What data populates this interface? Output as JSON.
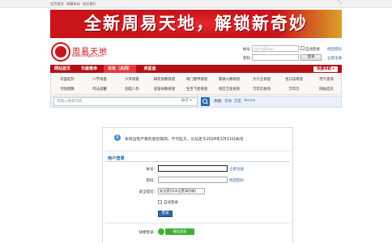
{
  "topbar": {
    "links": [
      "设为首页",
      "收藏本站",
      "社区银行"
    ]
  },
  "banner": {
    "text": "全新周易天地，解锁新奇妙"
  },
  "logo": {
    "name": "周易天地",
    "url": "www.f64gua.com"
  },
  "mini_login": {
    "account_label": "帐号",
    "account_placeholder": "用户名/Email",
    "auto_login_label": "自动登录",
    "retrieve_password": "找回密码",
    "password_label": "密码",
    "login_button": "登录",
    "register_link": "立即注册"
  },
  "nav": {
    "items": [
      "网站首页",
      "华盛黄命",
      "论坛（关闭）",
      "资星盘"
    ],
    "quick_nav": "快捷导航 ▾"
  },
  "subnav": {
    "row1": [
      "华盛起卦",
      "八字排盘",
      "六爻排盘",
      "梅花易数排盘",
      "奇门遁甲排盘",
      "紫微斗数排盘",
      "大六壬排盘",
      "金口诀排盘",
      "宅气查询"
    ],
    "row2": [
      "河洛理数",
      "鸣法战鑒",
      "割选八卦",
      "星宿命数排盘",
      "生世飞星排盘",
      "地区吉星查询",
      "万年历查询",
      "万年历",
      "网站首页"
    ]
  },
  "search": {
    "placeholder": "请输入搜索内容",
    "scope": "帖子 ▾",
    "hot_label": "热搜:",
    "hot_terms": [
      "活动",
      "交友",
      "discuz"
    ]
  },
  "alert": {
    "text": "系统出现严重的悲怆漏洞，不可乱方，论坛定于2024年1月11日关闭"
  },
  "login_form": {
    "title": "用户登录",
    "account_label": "帐号:",
    "register_link": "立即注册",
    "password_label": "密码:",
    "forgot_link": "找回密码",
    "security_label": "安全提问:",
    "security_option": "安全提问(未设置请忽略)",
    "auto_login": "自动登录",
    "submit": "登录",
    "quick_login_label": "快捷登录:",
    "wechat_button": "微信登录"
  }
}
